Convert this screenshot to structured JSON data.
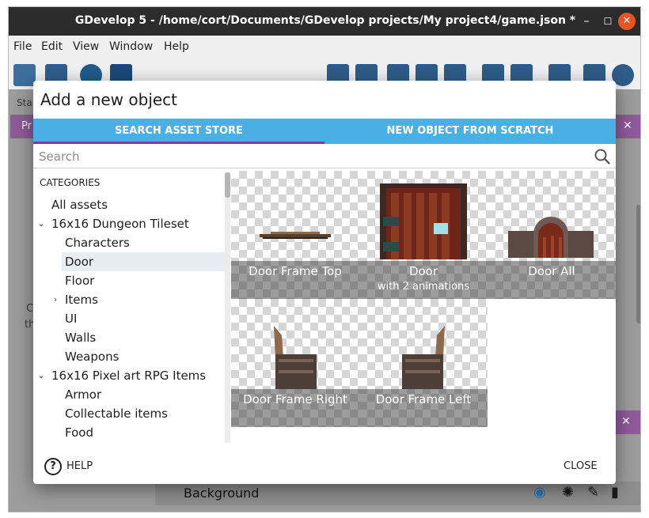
{
  "window": {
    "title": "GDevelop 5 - /home/cort/Documents/GDevelop projects/My project4/game.json *",
    "min_glyph": "–",
    "max_glyph": "☐",
    "close_glyph": "✕"
  },
  "menubar": [
    "File",
    "Edit",
    "View",
    "Window",
    "Help"
  ],
  "background": {
    "start_label": "Sta",
    "purple_tab_label": "Pr",
    "left_text_1": "C",
    "left_text_2": "th",
    "layer_row_label": "Background",
    "tab_close_glyph": "✕"
  },
  "dialog": {
    "title": "Add a new object",
    "tabs": [
      "SEARCH ASSET STORE",
      "NEW OBJECT FROM SCRATCH"
    ],
    "search_placeholder": "Search",
    "categories_title": "CATEGORIES",
    "categories": [
      {
        "label": "All assets",
        "level": 0,
        "chevron": ""
      },
      {
        "label": "16x16 Dungeon Tileset",
        "level": 0,
        "chevron": "down"
      },
      {
        "label": "Characters",
        "level": 1,
        "chevron": ""
      },
      {
        "label": "Door",
        "level": 1,
        "chevron": "",
        "selected": true
      },
      {
        "label": "Floor",
        "level": 1,
        "chevron": ""
      },
      {
        "label": "Items",
        "level": 1,
        "chevron": "right"
      },
      {
        "label": "UI",
        "level": 1,
        "chevron": ""
      },
      {
        "label": "Walls",
        "level": 1,
        "chevron": ""
      },
      {
        "label": "Weapons",
        "level": 1,
        "chevron": ""
      },
      {
        "label": "16x16 Pixel art RPG Items",
        "level": 0,
        "chevron": "down"
      },
      {
        "label": "Armor",
        "level": 1,
        "chevron": ""
      },
      {
        "label": "Collectable items",
        "level": 1,
        "chevron": ""
      },
      {
        "label": "Food",
        "level": 1,
        "chevron": ""
      }
    ],
    "assets": [
      {
        "name": "Door Frame Top",
        "sub": ""
      },
      {
        "name": "Door",
        "sub": "with 2 animations"
      },
      {
        "name": "Door All",
        "sub": ""
      },
      {
        "name": "Door Frame Right",
        "sub": ""
      },
      {
        "name": "Door Frame Left",
        "sub": ""
      }
    ],
    "help_label": "HELP",
    "help_glyph": "?",
    "close_label": "CLOSE"
  },
  "colors": {
    "tab_bar": "#4ab0e4",
    "tab_indicator": "#7b3ba8",
    "titlebar": "#2c2c2c",
    "close_circle": "#e95420"
  }
}
